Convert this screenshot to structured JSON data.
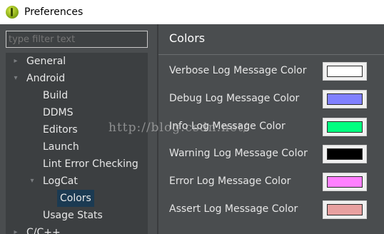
{
  "window": {
    "title": "Preferences",
    "icon": "eclipse-icon"
  },
  "filter": {
    "placeholder": "type filter text"
  },
  "tree": {
    "general": "General",
    "android": "Android",
    "build": "Build",
    "ddms": "DDMS",
    "editors": "Editors",
    "launch": "Launch",
    "lint": "Lint Error Checking",
    "logcat": "LogCat",
    "colors": "Colors",
    "usage": "Usage Stats",
    "cpp": "C/C++"
  },
  "page": {
    "title": "Colors",
    "rows": [
      {
        "label": "Verbose Log Message Color",
        "color": "#ffffff"
      },
      {
        "label": "Debug Log Message Color",
        "color": "#8080ff"
      },
      {
        "label": "Info Log Message Color",
        "color": "#00ff80"
      },
      {
        "label": "Warning Log Message Color",
        "color": "#000000"
      },
      {
        "label": "Error Log Message Color",
        "color": "#ff80ff"
      },
      {
        "label": "Assert Log Message Color",
        "color": "#e8a0a0"
      }
    ]
  },
  "watermark": "http://blog.csdn.net/"
}
